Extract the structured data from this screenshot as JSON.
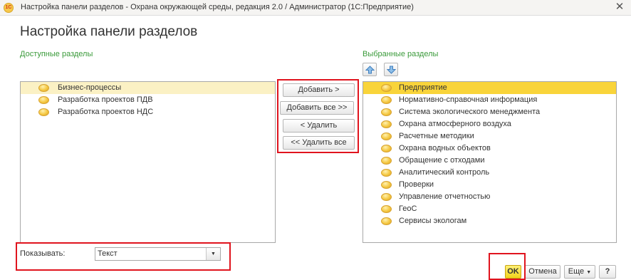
{
  "window": {
    "logo_text": "1С",
    "title": "Настройка панели разделов - Охрана окружающей среды, редакция 2.0 / Администратор  (1С:Предприятие)",
    "close_glyph": "✕"
  },
  "page": {
    "title": "Настройка панели разделов"
  },
  "available": {
    "label": "Доступные разделы",
    "items": [
      {
        "label": "Бизнес-процессы",
        "selected": true
      },
      {
        "label": "Разработка проектов ПДВ",
        "selected": false
      },
      {
        "label": "Разработка проектов НДС",
        "selected": false
      }
    ]
  },
  "selected": {
    "label": "Выбранные разделы",
    "items": [
      {
        "label": "Предприятие",
        "selected": true
      },
      {
        "label": "Нормативно-справочная информация",
        "selected": false
      },
      {
        "label": "Система экологического менеджмента",
        "selected": false
      },
      {
        "label": "Охрана атмосферного воздуха",
        "selected": false
      },
      {
        "label": "Расчетные методики",
        "selected": false
      },
      {
        "label": "Охрана водных объектов",
        "selected": false
      },
      {
        "label": "Обращение с отходами",
        "selected": false
      },
      {
        "label": "Аналитический контроль",
        "selected": false
      },
      {
        "label": "Проверки",
        "selected": false
      },
      {
        "label": "Управление отчетностью",
        "selected": false
      },
      {
        "label": "ГеоС",
        "selected": false
      },
      {
        "label": "Сервисы экологам",
        "selected": false
      }
    ]
  },
  "actions": {
    "add": "Добавить >",
    "add_all": "Добавить все >>",
    "remove": "< Удалить",
    "remove_all": "<< Удалить все"
  },
  "filter": {
    "label": "Показывать:",
    "value": "Текст"
  },
  "footer": {
    "ok": "OK",
    "cancel": "Отмена",
    "more": "Еще",
    "help": "?"
  },
  "colors": {
    "accent_green": "#3a9a3a",
    "highlight_red": "#e0141e",
    "selection_yellow": "#f9d43a",
    "ok_yellow": "#f2d21a"
  }
}
